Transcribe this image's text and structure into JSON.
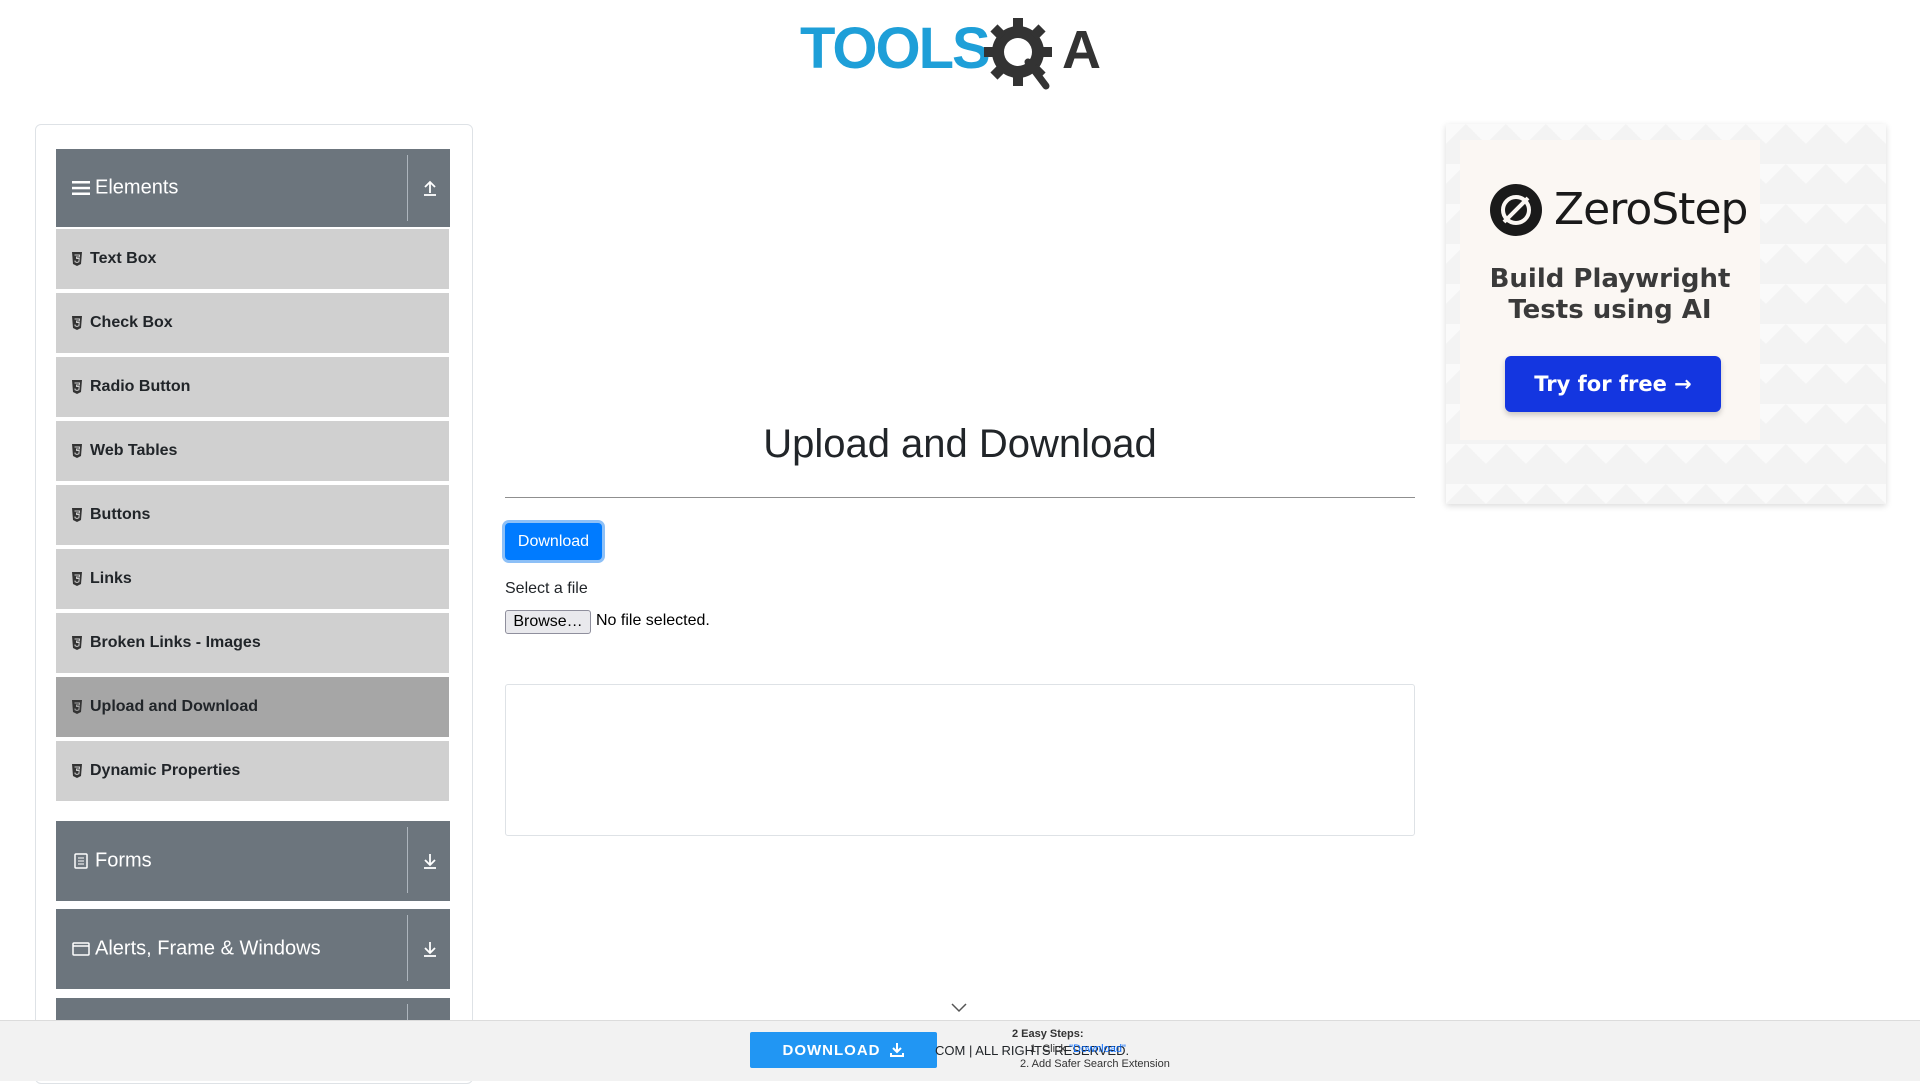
{
  "header": {
    "logo_alt": "TOOLSQA",
    "logo_text_left": "TOOLS",
    "logo_text_right": "A"
  },
  "sidebar": {
    "groups": [
      {
        "title": "Elements",
        "icon": "hamburger-icon",
        "toggle_icon": "collapse-up-icon",
        "expanded": true
      },
      {
        "title": "Forms",
        "icon": "form-icon",
        "toggle_icon": "expand-down-icon",
        "expanded": false
      },
      {
        "title": "Alerts, Frame & Windows",
        "icon": "window-icon",
        "toggle_icon": "expand-down-icon",
        "expanded": false
      }
    ],
    "items": [
      {
        "label": "Text Box"
      },
      {
        "label": "Check Box"
      },
      {
        "label": "Radio Button"
      },
      {
        "label": "Web Tables"
      },
      {
        "label": "Buttons"
      },
      {
        "label": "Links"
      },
      {
        "label": "Broken Links - Images"
      },
      {
        "label": "Upload and Download",
        "active": true
      },
      {
        "label": "Dynamic Properties"
      }
    ]
  },
  "main": {
    "title": "Upload and Download",
    "download_label": "Download",
    "select_file_label": "Select a file",
    "browse_label": "Browse…",
    "file_status": "No file selected."
  },
  "ad": {
    "brand": "ZeroStep",
    "tagline_line1": "Build Playwright",
    "tagline_line2": "Tests using AI",
    "cta": "Try for free →"
  },
  "footer": {
    "download_label": "DOWNLOAD",
    "copyright_text": "COM | ALL RIGHTS RESERVED.",
    "steps_title": "2 Easy Steps:",
    "step1_prefix": "1. Click ",
    "step1_link": "\"Download\"",
    "step2": "2. Add Safer Search Extension"
  },
  "colors": {
    "sidebar_header": "#6c757d",
    "menu_item": "#d0d0d0",
    "menu_item_active": "#a6a6a6",
    "primary": "#007bff",
    "ad_cta": "#1436e0",
    "footer_button": "#2196f3",
    "logo_blue": "#1e9fd8",
    "logo_dark": "#333333"
  }
}
